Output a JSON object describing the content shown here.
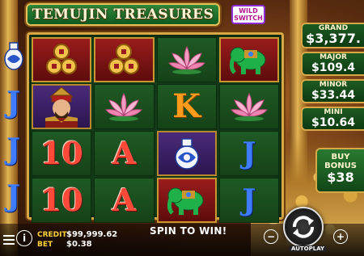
{
  "game": {
    "title": "TEMUJIN TREASURES",
    "wild_badge": "WILD SWITCH"
  },
  "reels": {
    "col1": [
      "lucky-coins-symbol",
      "temujin-warrior-symbol",
      "10",
      "10"
    ],
    "col2": [
      "lucky-coins-symbol",
      "lotus-flower-symbol",
      "A",
      "A"
    ],
    "col3": [
      "lotus-flower-symbol",
      "K",
      "porcelain-vase-symbol",
      "jade-elephant-symbol"
    ],
    "col4": [
      "jade-elephant-symbol",
      "lotus-flower-symbol",
      "J",
      "J"
    ],
    "left_strip": [
      "porcelain-vase-symbol",
      "J",
      "J",
      "J"
    ]
  },
  "jackpots": {
    "grand": {
      "label": "GRAND",
      "value": "$3,377."
    },
    "major": {
      "label": "MAJOR",
      "value": "$109.4"
    },
    "minor": {
      "label": "MINOR",
      "value": "$33.44"
    },
    "mini": {
      "label": "MINI",
      "value": "$10.64"
    }
  },
  "buy_bonus": {
    "label": "BUY BONUS",
    "value": "$38"
  },
  "footer": {
    "credit_label": "CREDIT",
    "credit_value": "$99,999.62",
    "bet_label": "BET",
    "bet_value": "$0.38",
    "message": "SPIN TO WIN!",
    "autoplay_label": "AUTOPLAY",
    "info_symbol": "i",
    "minus_symbol": "−",
    "plus_symbol": "+"
  },
  "colors": {
    "reel_bg": "#164218",
    "frame_gold": "#d9a846",
    "ten_red": "#ff4a3a",
    "king_orange": "#ff9a1a",
    "jack_blue": "#3e7bff",
    "credit_label_yellow": "#ffd23a"
  }
}
